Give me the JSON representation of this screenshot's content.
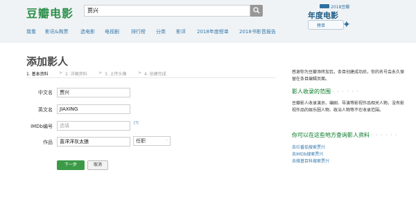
{
  "header": {
    "logo": "豆瓣电影",
    "search_value": "贾兴",
    "nav": [
      "我看",
      "影讯&购票",
      "选电影",
      "电视剧",
      "排行榜",
      "分类",
      "影评",
      "2018年度榜单",
      "2018书影音报告"
    ],
    "promo": {
      "tag": "2018豆瓣",
      "big": "年度电影",
      "box_text": "榜单"
    }
  },
  "page": {
    "title": "添加影人",
    "steps": [
      "1. 基本资料",
      ">",
      "2. 详细资料",
      ">",
      "3. 上传头像",
      ">",
      "4. 创建完成"
    ]
  },
  "form": {
    "chinese_name_label": "中文名",
    "chinese_name_value": "贾兴",
    "english_name_label": "英文名",
    "english_name_value": "JIAXING",
    "imdb_label": "IMDb编号",
    "imdb_placeholder": "选填",
    "imdb_help": "[?]",
    "works_label": "作品",
    "works_value": "喜洋洋灰太狼",
    "role_value": "任职",
    "next_label": "下一步",
    "cancel_label": "取消"
  },
  "sidebar": {
    "intro": "感谢你为豆瓣添砖加瓦，条目创建成功后，你的名号会永久保留在条目编辑页面。",
    "scope_title": "影人收录的范围",
    "scope_dots": "· · · · · ·",
    "scope_text": "豆瓣影人收录演员、编剧、导演等影视作品相关人物，没有影视作品的娱乐圈人物、政治人物等不在收录范围。",
    "where_title": "你可以在这些地方查询影人资料",
    "where_dots": "· · · · · ·",
    "links": [
      "去烂番茄搜索贾兴",
      "去IMDb搜索贾兴",
      "去维基百科搜索贾兴"
    ]
  }
}
